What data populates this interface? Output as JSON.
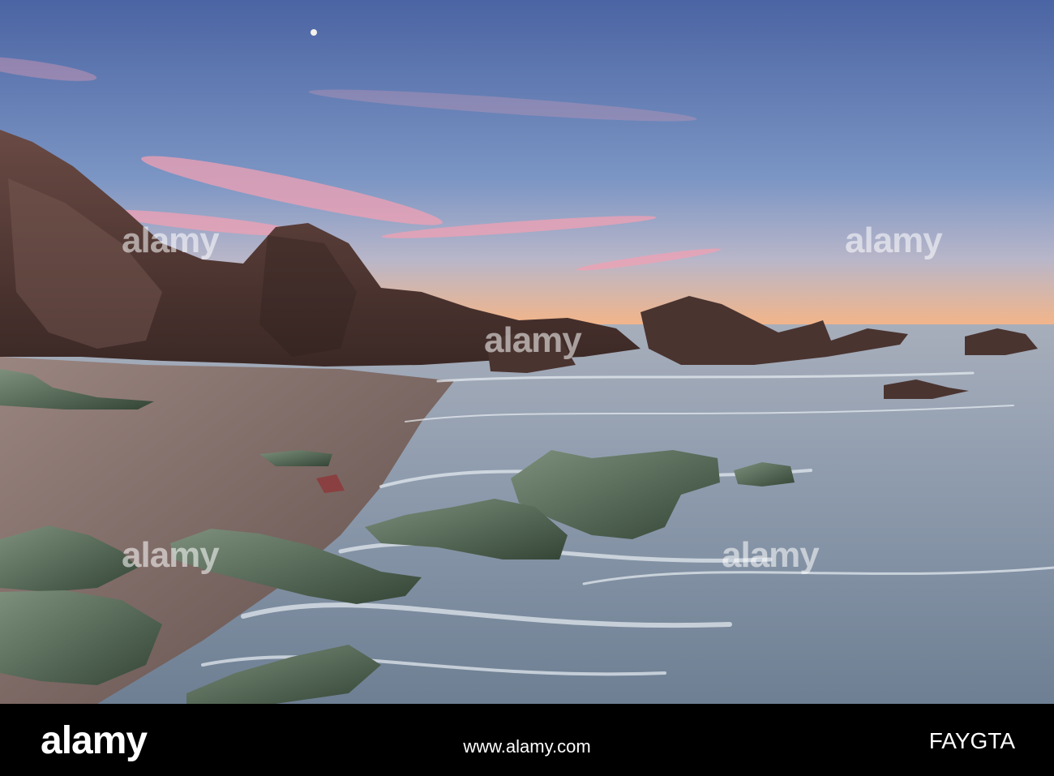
{
  "watermark": {
    "brand": "alamy",
    "image_id": "FAYGTA",
    "url": "www.alamy.com"
  },
  "scene": {
    "sky_top_color": "#4f6aa8",
    "sky_horizon_color": "#f2b58a",
    "cloud_color": "#f2a0b0",
    "rock_color": "#5a3f3a",
    "green_rock_color": "#5f7560",
    "sea_color": "#9aa6b4",
    "sand_color": "#8e7d78"
  }
}
